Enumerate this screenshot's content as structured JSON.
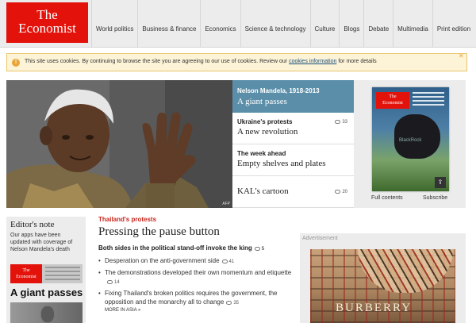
{
  "header": {
    "logo_line1": "The",
    "logo_line2": "Economist",
    "nav": [
      "World politics",
      "Business & finance",
      "Economics",
      "Science & technology",
      "Culture",
      "Blogs",
      "Debate",
      "Multimedia",
      "Print edition"
    ]
  },
  "cookie": {
    "icon_text": "!",
    "text_before": "This site uses cookies. By continuing to browse the site you are agreeing to our use of cookies. Review our ",
    "link_text": "cookies information",
    "text_after": " for more details",
    "close": "✕"
  },
  "hero": {
    "credit": "AFP"
  },
  "stories": {
    "top": {
      "rubric": "Nelson Mandela, 1918-2013",
      "headline": "A giant passes"
    },
    "items": [
      {
        "rubric": "Ukraine's protests",
        "headline": "A new revolution",
        "comments": "33"
      },
      {
        "rubric": "The week ahead",
        "headline": "Empty shelves and plates",
        "comments": ""
      },
      {
        "rubric": "",
        "headline": "KAL's cartoon",
        "comments": "20"
      }
    ]
  },
  "cover": {
    "logo_line1": "The",
    "logo_line2": "Economist",
    "rock_label": "BlackRock",
    "full_contents": "Full contents",
    "subscribe": "Subscribe"
  },
  "editors_note": {
    "title": "Editor's note",
    "body": "Our apps have been updated with coverage of Nelson Mandela's death",
    "mini_logo1": "The",
    "mini_logo2": "Economist",
    "mini_headline": "A giant passes"
  },
  "article": {
    "rubric": "Thailand's protests",
    "title": "Pressing the pause button",
    "subtitle": "Both sides in the political stand-off invoke the king",
    "subtitle_comments": "5",
    "bullets": [
      {
        "text": "Desperation on the anti-government side",
        "comments": "41"
      },
      {
        "text": "The demonstrations developed their own momentum and etiquette",
        "comments": "14"
      },
      {
        "text": "Fixing Thailand's broken politics requires the government, the opposition and the monarchy all to change",
        "comments": "35"
      }
    ],
    "more": "MORE IN ASIA »"
  },
  "ad": {
    "label": "Advertisement",
    "brand": "BURBERRY"
  },
  "colors": {
    "brand_red": "#e3120b",
    "top_story_blue": "#5b8ea9",
    "rubric_red": "#c8261d"
  }
}
